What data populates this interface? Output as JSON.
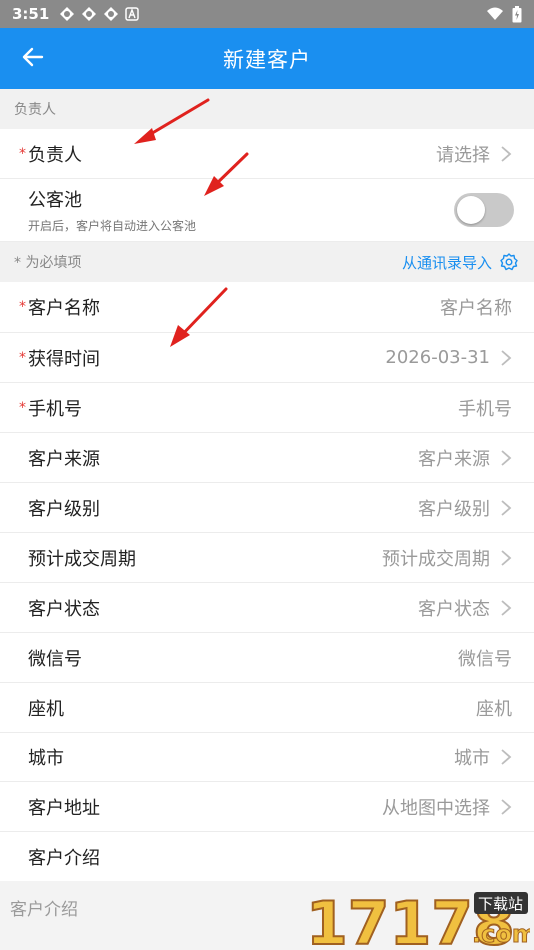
{
  "status": {
    "time": "3:51"
  },
  "header": {
    "title": "新建客户"
  },
  "section_owner": {
    "title": "负责人"
  },
  "owner_row": {
    "required": "*",
    "label": "负责人",
    "value": "请选择"
  },
  "pool_row": {
    "title": "公客池",
    "subtitle": "开启后，客户将自动进入公客池",
    "enabled": false
  },
  "section_required": {
    "note": "* 为必填项",
    "import_label": "从通讯录导入"
  },
  "fields": [
    {
      "required": "*",
      "label": "客户名称",
      "value": "客户名称"
    },
    {
      "required": "*",
      "label": "获得时间",
      "value": "2026-03-31"
    },
    {
      "required": "*",
      "label": "手机号",
      "value": "手机号"
    },
    {
      "required": "",
      "label": "客户来源",
      "value": "客户来源"
    },
    {
      "required": "",
      "label": "客户级别",
      "value": "客户级别"
    },
    {
      "required": "",
      "label": "预计成交周期",
      "value": "预计成交周期"
    },
    {
      "required": "",
      "label": "客户状态",
      "value": "客户状态"
    },
    {
      "required": "",
      "label": "微信号",
      "value": "微信号"
    },
    {
      "required": "",
      "label": "座机",
      "value": "座机"
    },
    {
      "required": "",
      "label": "城市",
      "value": "城市"
    },
    {
      "required": "",
      "label": "客户地址",
      "value": "从地图中选择"
    },
    {
      "required": "",
      "label": "客户介绍",
      "value": ""
    }
  ],
  "intro": {
    "placeholder": "客户介绍"
  },
  "watermark": {
    "text": "17178",
    "sub": ".com",
    "badge": "下载站"
  },
  "colors": {
    "primary": "#1a8ff0",
    "required": "#e53935",
    "arrow": "#e0221e"
  }
}
